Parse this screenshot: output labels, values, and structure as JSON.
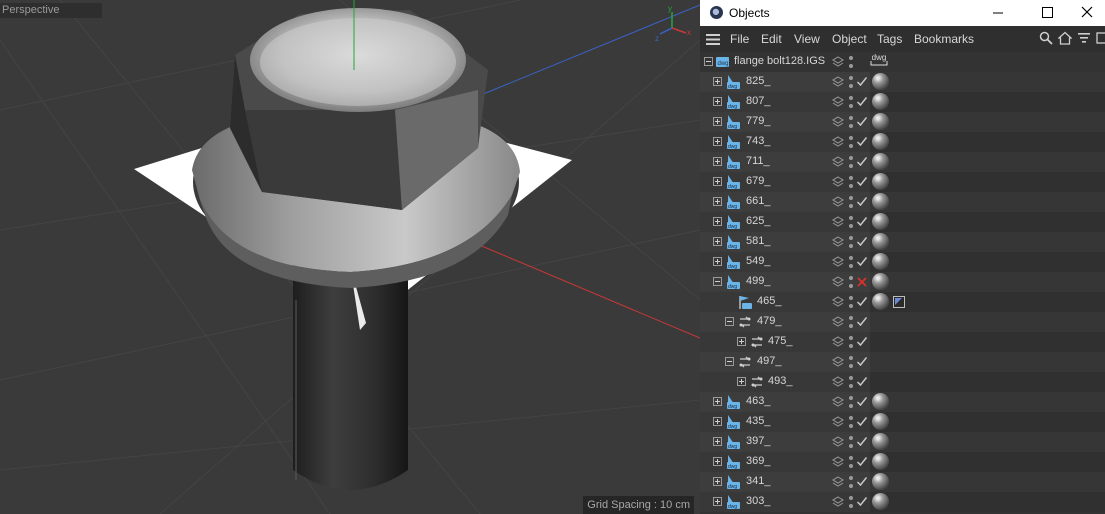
{
  "viewport": {
    "label": "Perspective",
    "grid_spacing": "Grid Spacing : 10 cm"
  },
  "window": {
    "title": "Objects",
    "controls": [
      "minimize-icon",
      "maximize-icon",
      "close-icon"
    ]
  },
  "menu": {
    "items": [
      "File",
      "Edit",
      "View",
      "Object",
      "Tags",
      "Bookmarks"
    ],
    "tools": [
      "search-icon",
      "home-icon",
      "filter-icon",
      "new-window-icon"
    ]
  },
  "root": {
    "name": "flange bolt128.IGS",
    "tag_label": "dwg"
  },
  "rows": [
    {
      "name": "825_",
      "type": "dwg",
      "level": 1,
      "expander": "plus",
      "material": true
    },
    {
      "name": "807_",
      "type": "dwg",
      "level": 1,
      "expander": "plus",
      "material": true
    },
    {
      "name": "779_",
      "type": "dwg",
      "level": 1,
      "expander": "plus",
      "material": true
    },
    {
      "name": "743_",
      "type": "dwg",
      "level": 1,
      "expander": "plus",
      "material": true
    },
    {
      "name": "711_",
      "type": "dwg",
      "level": 1,
      "expander": "plus",
      "material": true
    },
    {
      "name": "679_",
      "type": "dwg",
      "level": 1,
      "expander": "plus",
      "material": true
    },
    {
      "name": "661_",
      "type": "dwg",
      "level": 1,
      "expander": "plus",
      "material": true
    },
    {
      "name": "625_",
      "type": "dwg",
      "level": 1,
      "expander": "plus",
      "material": true
    },
    {
      "name": "581_",
      "type": "dwg",
      "level": 1,
      "expander": "plus",
      "material": true
    },
    {
      "name": "549_",
      "type": "dwg",
      "level": 1,
      "expander": "plus",
      "material": true
    },
    {
      "name": "499_",
      "type": "dwg",
      "level": 1,
      "expander": "minus",
      "material": true,
      "state": "disabled"
    },
    {
      "name": "465_",
      "type": "flag",
      "level": 2,
      "expander": "none",
      "material": true,
      "extra_tag": true
    },
    {
      "name": "479_",
      "type": "sym",
      "level": 2,
      "expander": "minus",
      "material": false
    },
    {
      "name": "475_",
      "type": "sym",
      "level": 3,
      "expander": "plus",
      "material": false
    },
    {
      "name": "497_",
      "type": "sym",
      "level": 2,
      "expander": "minus",
      "material": false
    },
    {
      "name": "493_",
      "type": "sym",
      "level": 3,
      "expander": "plus",
      "material": false
    },
    {
      "name": "463_",
      "type": "dwg",
      "level": 1,
      "expander": "plus",
      "material": true
    },
    {
      "name": "435_",
      "type": "dwg",
      "level": 1,
      "expander": "plus",
      "material": true
    },
    {
      "name": "397_",
      "type": "dwg",
      "level": 1,
      "expander": "plus",
      "material": true
    },
    {
      "name": "369_",
      "type": "dwg",
      "level": 1,
      "expander": "plus",
      "material": true
    },
    {
      "name": "341_",
      "type": "dwg",
      "level": 1,
      "expander": "plus",
      "material": true
    },
    {
      "name": "303_",
      "type": "dwg",
      "level": 1,
      "expander": "plus",
      "material": true
    }
  ],
  "colors": {
    "check": "#c8c8c8",
    "disabled_x": "#e0302a",
    "axis_y": "#23a83a",
    "axis_x": "#c83838",
    "axis_z": "#3a62c8",
    "dwg_icon": "#6ab4e8"
  }
}
